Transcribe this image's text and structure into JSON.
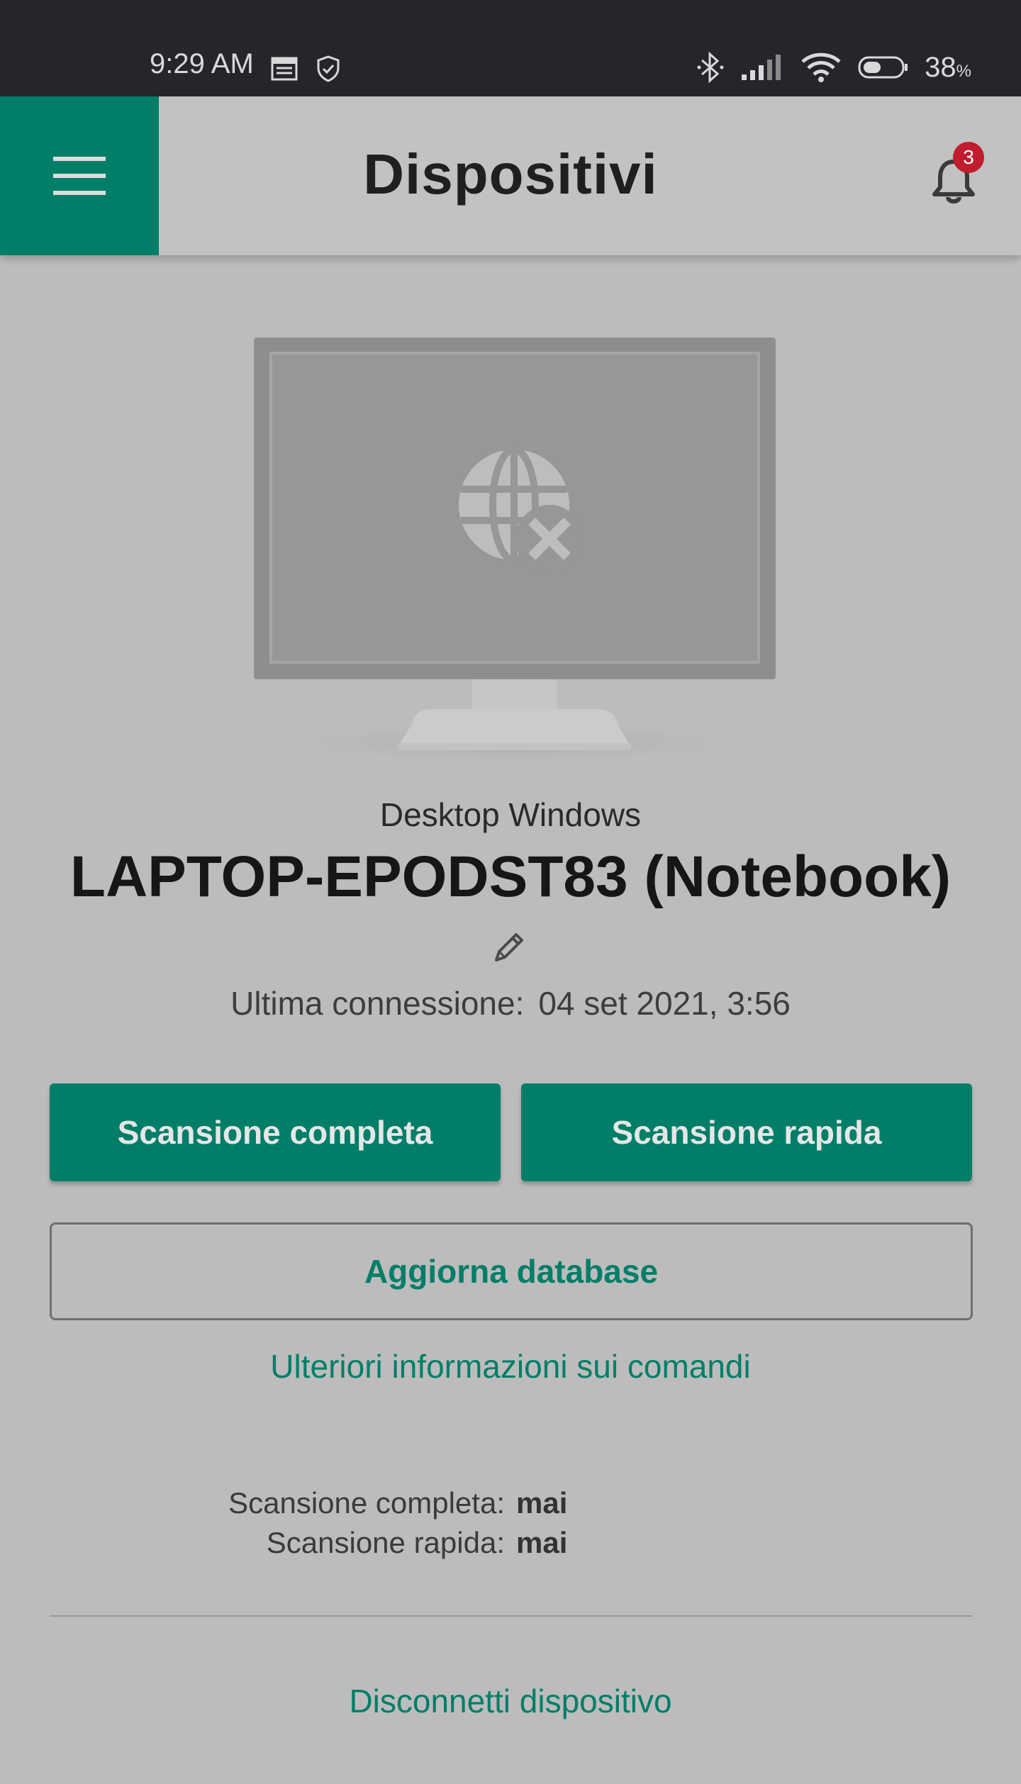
{
  "status_bar": {
    "time": "9:29 AM",
    "battery_percent": "38",
    "battery_unit": "%",
    "icons": [
      "calendar-icon",
      "shield-check-icon",
      "bluetooth-icon",
      "signal-icon",
      "wifi-icon",
      "battery-icon"
    ]
  },
  "app_bar": {
    "title": "Dispositivi",
    "notification_count": "3",
    "accent_color": "#007e68",
    "badge_color": "#c01d2e"
  },
  "device": {
    "type": "Desktop Windows",
    "name": "LAPTOP-EPODST83 (Notebook)",
    "last_connection_label": "Ultima connessione:",
    "last_connection_value": "04 set 2021, 3:56",
    "status_icon": "globe-disconnected-icon"
  },
  "actions": {
    "full_scan": "Scansione completa",
    "quick_scan": "Scansione rapida",
    "update_db": "Aggiorna database",
    "more_info": "Ulteriori informazioni sui comandi"
  },
  "scan_history": [
    {
      "label": "Scansione completa:",
      "value": "mai"
    },
    {
      "label": "Scansione rapida:",
      "value": "mai"
    }
  ],
  "footer": {
    "disconnect": "Disconnetti dispositivo"
  }
}
